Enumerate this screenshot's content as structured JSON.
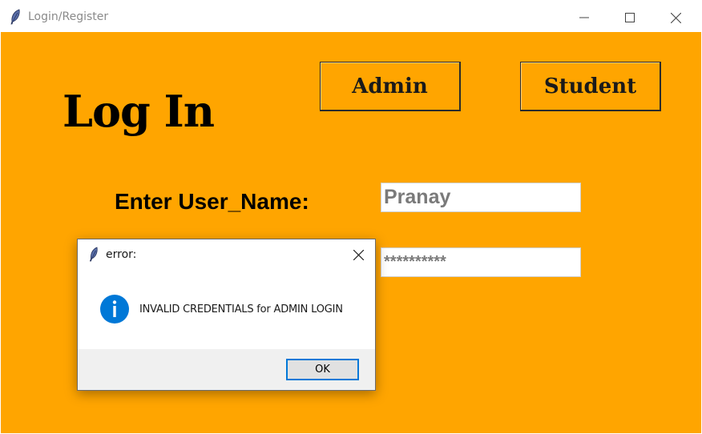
{
  "window": {
    "title": "Login/Register",
    "app_icon": "feather-icon",
    "controls": {
      "minimize": "minimize-icon",
      "maximize": "maximize-icon",
      "close": "close-icon"
    }
  },
  "main": {
    "heading": "Log In",
    "admin_label": "Admin",
    "student_label": "Student",
    "username_label": "Enter User_Name:",
    "username_value": "Pranay",
    "password_value": "**********"
  },
  "dialog": {
    "title": "error:",
    "message": "INVALID CREDENTIALS for ADMIN LOGIN",
    "icon": "info-icon",
    "ok_label": "OK"
  },
  "colors": {
    "background": "#ffa500",
    "info_icon": "#0078d7",
    "focus_border": "#0078d7"
  }
}
